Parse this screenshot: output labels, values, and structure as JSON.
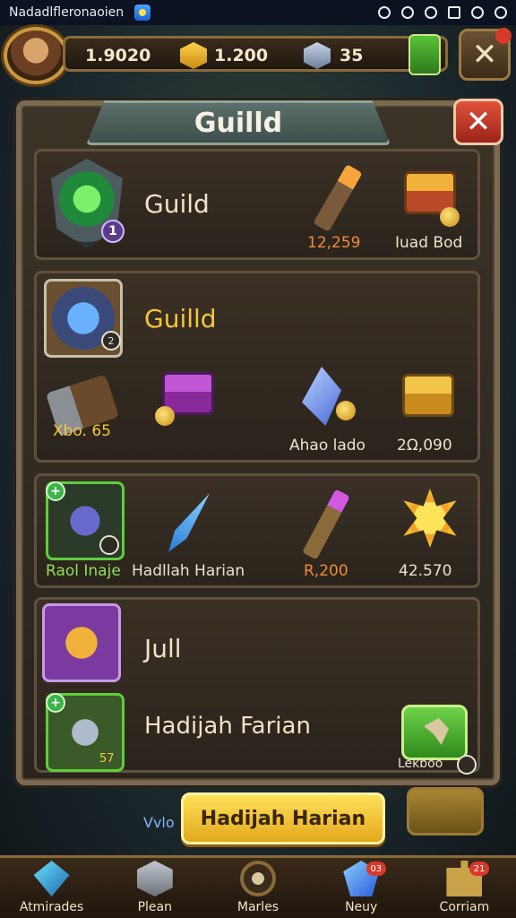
{
  "status_bar": {
    "carrier": "Nadadlfleronaoien"
  },
  "resources": {
    "coins": "1.9020",
    "gold": "1.200",
    "gems": "35"
  },
  "panel": {
    "title": "Guilld"
  },
  "card_a": {
    "heading": "Guild",
    "emblem_level": "1",
    "item1_value": "12,259",
    "item2_label": "Iuad Bod"
  },
  "card_b": {
    "heading": "Guilld",
    "badge": "2",
    "item1_label": "Xbo. 65",
    "item3_label": "Ahao lado",
    "item4_label": "2Ω,090"
  },
  "card_c": {
    "item1_label": "Raol  Inaje",
    "item2_label": "Hadllah Harian",
    "item3_value": "R,200",
    "item4_value": "42.570"
  },
  "card_d": {
    "heading1": "Jull",
    "heading2": "Hadijah Farian",
    "side_badge": "57",
    "button_label": "Lekboo"
  },
  "main_button": {
    "label": "Hadijah Harian"
  },
  "vivo_text": "Vvlo",
  "bottom_nav": [
    {
      "label": "Atmirades",
      "icon": "gem-icon",
      "badge": ""
    },
    {
      "label": "Plean",
      "icon": "box-icon",
      "badge": ""
    },
    {
      "label": "Marles",
      "icon": "ring-icon",
      "badge": ""
    },
    {
      "label": "Neuy",
      "icon": "crystal-icon",
      "badge": "03"
    },
    {
      "label": "Corriam",
      "icon": "puzzle-icon",
      "badge": "21"
    }
  ],
  "colors": {
    "accent_gold": "#f4c63a",
    "panel_border": "#7a6a52",
    "close_red": "#d63a2a"
  }
}
